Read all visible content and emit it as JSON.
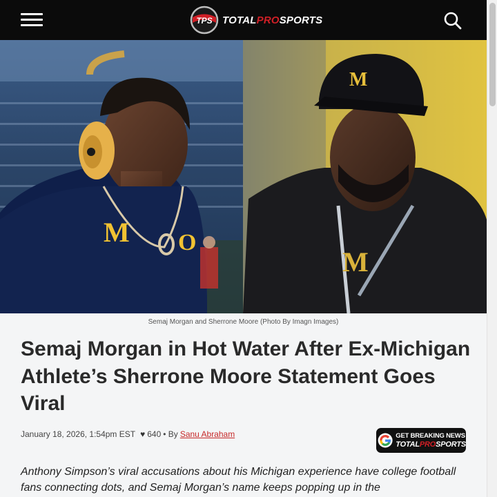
{
  "header": {
    "logo_mark": "TPS",
    "logo_word_1": "TOTAL",
    "logo_word_2": "PRO",
    "logo_word_3": "SPORTS",
    "menu_icon": "hamburger-menu-icon",
    "search_icon": "search-icon"
  },
  "article": {
    "caption": "Semaj Morgan and Sherrone Moore (Photo By Imagn Images)",
    "headline": "Semaj Morgan in Hot Water After Ex-Michigan Athlete’s Sherrone Moore Statement Goes Viral",
    "date": "January 18, 2026, 1:54pm EST",
    "likes": "640",
    "by_label": "• By",
    "author": "Sanu Abraham",
    "intro": "Anthony Simpson’s viral accusations about his Michigan experience have college football fans connecting dots, and Semaj Morgan’s name keeps popping up in the"
  },
  "badge": {
    "line1": "GET BREAKING NEWS",
    "line2_a": "TOTAL",
    "line2_b": "PRO",
    "line2_c": "SPORTS"
  },
  "hero": {
    "left_letter": "M",
    "left_number": "O",
    "right_cap_letter": "M",
    "right_shirt_letter": "M"
  },
  "colors": {
    "brand_red": "#d01f26",
    "header_bg": "#0b0b0b",
    "michigan_maize": "#f1c232",
    "michigan_blue": "#0f1f4a"
  }
}
